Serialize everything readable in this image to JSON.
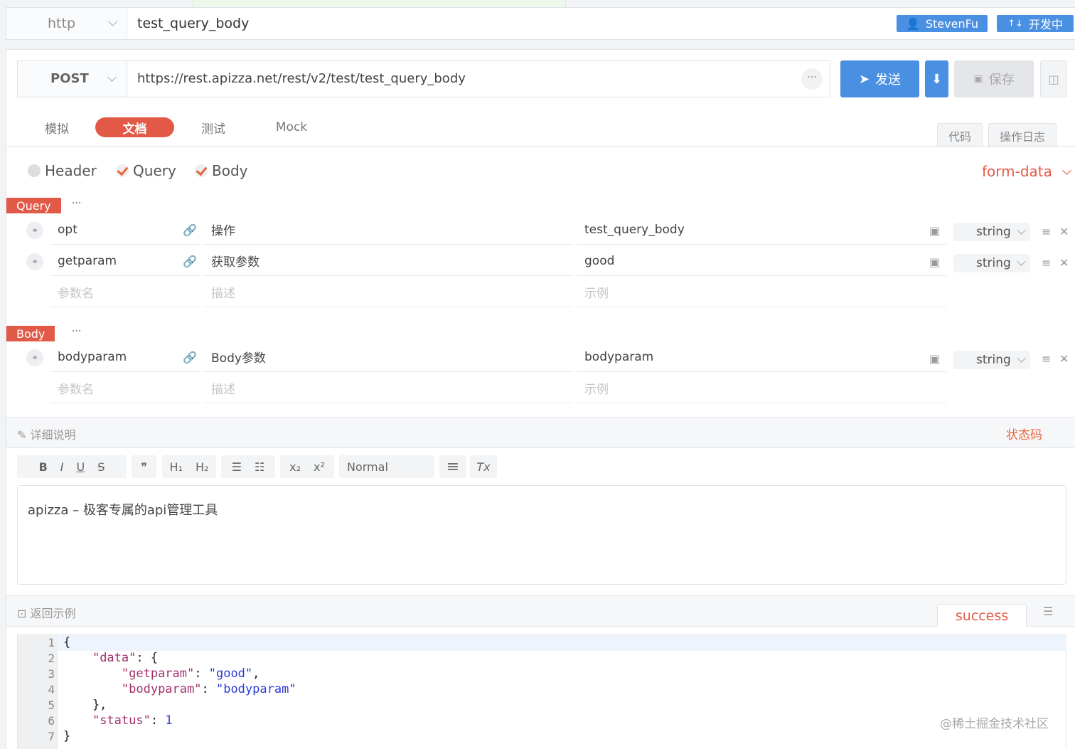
{
  "topbar": {
    "protocol": "http",
    "api_name": "test_query_body",
    "user_name": "StevenFu",
    "user_icon": "user-icon",
    "status_arrows": "↑↓",
    "status_label": "开发中"
  },
  "request": {
    "method": "POST",
    "url": "https://rest.apizza.net/rest/v2/test/test_query_body",
    "more": "···",
    "send_label": "发送",
    "save_label": "保存"
  },
  "tabs": {
    "items": [
      "模拟",
      "文档",
      "测试",
      "Mock"
    ],
    "active": "文档",
    "right": [
      "代码",
      "操作日志"
    ]
  },
  "sections_toggle": {
    "header": "Header",
    "query": "Query",
    "body": "Body",
    "header_checked": false,
    "query_checked": true,
    "body_checked": true,
    "body_format": "form-data"
  },
  "query": {
    "tag": "Query",
    "more": "···",
    "rows": [
      {
        "name": "opt",
        "desc": "操作",
        "example": "test_query_body",
        "type": "string"
      },
      {
        "name": "getparam",
        "desc": "获取参数",
        "example": "good",
        "type": "string"
      }
    ],
    "placeholder": {
      "name": "参数名",
      "desc": "描述",
      "example": "示例"
    }
  },
  "body": {
    "tag": "Body",
    "more": "···",
    "rows": [
      {
        "name": "bodyparam",
        "desc": "Body参数",
        "example": "bodyparam",
        "type": "string"
      }
    ],
    "placeholder": {
      "name": "参数名",
      "desc": "描述",
      "example": "示例"
    }
  },
  "detail": {
    "title": "详细说明",
    "status_code_label": "状态码",
    "toolbar": {
      "bold": "B",
      "italic": "I",
      "underline": "U",
      "strike": "S",
      "quote": "❞",
      "h1": "H₁",
      "h2": "H₂",
      "ol": "☰",
      "ul": "☷",
      "sub": "x₂",
      "sup": "x²",
      "format": "Normal",
      "align": "≡",
      "clear": "Tx"
    },
    "content": "apizza – 极客专属的api管理工具"
  },
  "response": {
    "title": "返回示例",
    "tab": "success",
    "line_numbers": [
      "1",
      "2",
      "3",
      "4",
      "5",
      "6",
      "7"
    ]
  },
  "watermark": "@稀土掘金技术社区"
}
